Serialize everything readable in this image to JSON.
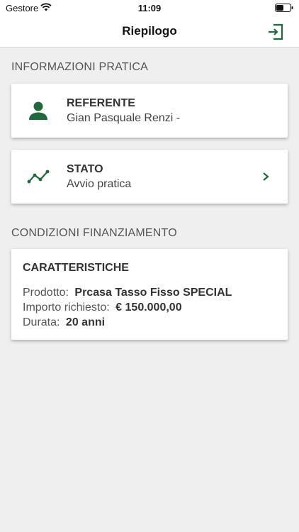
{
  "status_bar": {
    "carrier": "Gestore",
    "time": "11:09"
  },
  "nav": {
    "title": "Riepilogo"
  },
  "sections": {
    "info_header": "INFORMAZIONI PRATICA",
    "conditions_header": "CONDIZIONI FINANZIAMENTO"
  },
  "referente": {
    "title": "REFERENTE",
    "value": "Gian Pasquale Renzi -"
  },
  "stato": {
    "title": "STATO",
    "value": "Avvio pratica"
  },
  "caratteristiche": {
    "title": "CARATTERISTICHE",
    "rows": [
      {
        "label": "Prodotto:",
        "value": "Prcasa Tasso Fisso SPECIAL"
      },
      {
        "label": "Importo richiesto:",
        "value": "€ 150.000,00"
      },
      {
        "label": "Durata:",
        "value": "20 anni"
      }
    ]
  },
  "colors": {
    "accent": "#1f6a3a",
    "background": "#efefef"
  }
}
